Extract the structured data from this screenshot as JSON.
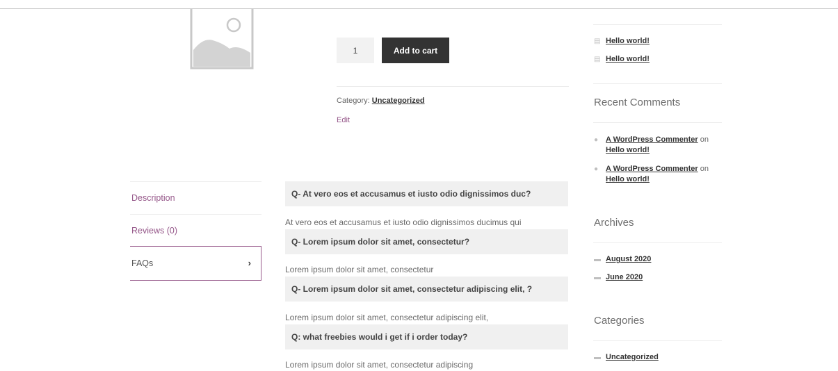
{
  "product": {
    "image_icon": "image-placeholder-icon",
    "quantity": "1",
    "add_to_cart_label": "Add to cart",
    "category_label": "Category:",
    "category_value": "Uncategorized",
    "edit_label": "Edit"
  },
  "tabs": [
    {
      "label": "Description",
      "active": false
    },
    {
      "label": "Reviews (0)",
      "active": false
    },
    {
      "label": "FAQs",
      "active": true,
      "icon": "chevron-right-icon"
    }
  ],
  "faqs": [
    {
      "question": "Q- At vero eos et accusamus et iusto odio dignissimos duc?",
      "answer": "At vero eos et accusamus et iusto odio dignissimos ducimus qui"
    },
    {
      "question": "Q- Lorem ipsum dolor sit amet, consectetur?",
      "answer": "Lorem ipsum dolor sit amet, consectetur"
    },
    {
      "question": "Q- Lorem ipsum dolor sit amet, consectetur adipiscing elit, ?",
      "answer": "Lorem ipsum dolor sit amet, consectetur adipiscing elit,"
    },
    {
      "question": "Q: what freebies would i get if i order today?",
      "answer": "Lorem ipsum dolor sit amet, consectetur adipiscing"
    }
  ],
  "sidebar": {
    "recent_posts": [
      {
        "label": "Hello world!",
        "icon": "document-icon"
      },
      {
        "label": "Hello world!",
        "icon": "document-icon"
      }
    ],
    "recent_comments_title": "Recent Comments",
    "recent_comments": [
      {
        "author": "A WordPress Commenter",
        "on": "on",
        "post": "Hello world!",
        "icon": "comment-icon"
      },
      {
        "author": "A WordPress Commenter",
        "on": "on",
        "post": "Hello world!",
        "icon": "comment-icon"
      }
    ],
    "archives_title": "Archives",
    "archives": [
      {
        "label": "August 2020",
        "icon": "folder-icon"
      },
      {
        "label": "June 2020",
        "icon": "folder-icon"
      }
    ],
    "categories_title": "Categories",
    "categories": [
      {
        "label": "Uncategorized",
        "icon": "folder-icon"
      }
    ]
  },
  "colors": {
    "accent": "#96588a",
    "button_bg": "#333333",
    "faq_bg": "#f0f0f0"
  }
}
